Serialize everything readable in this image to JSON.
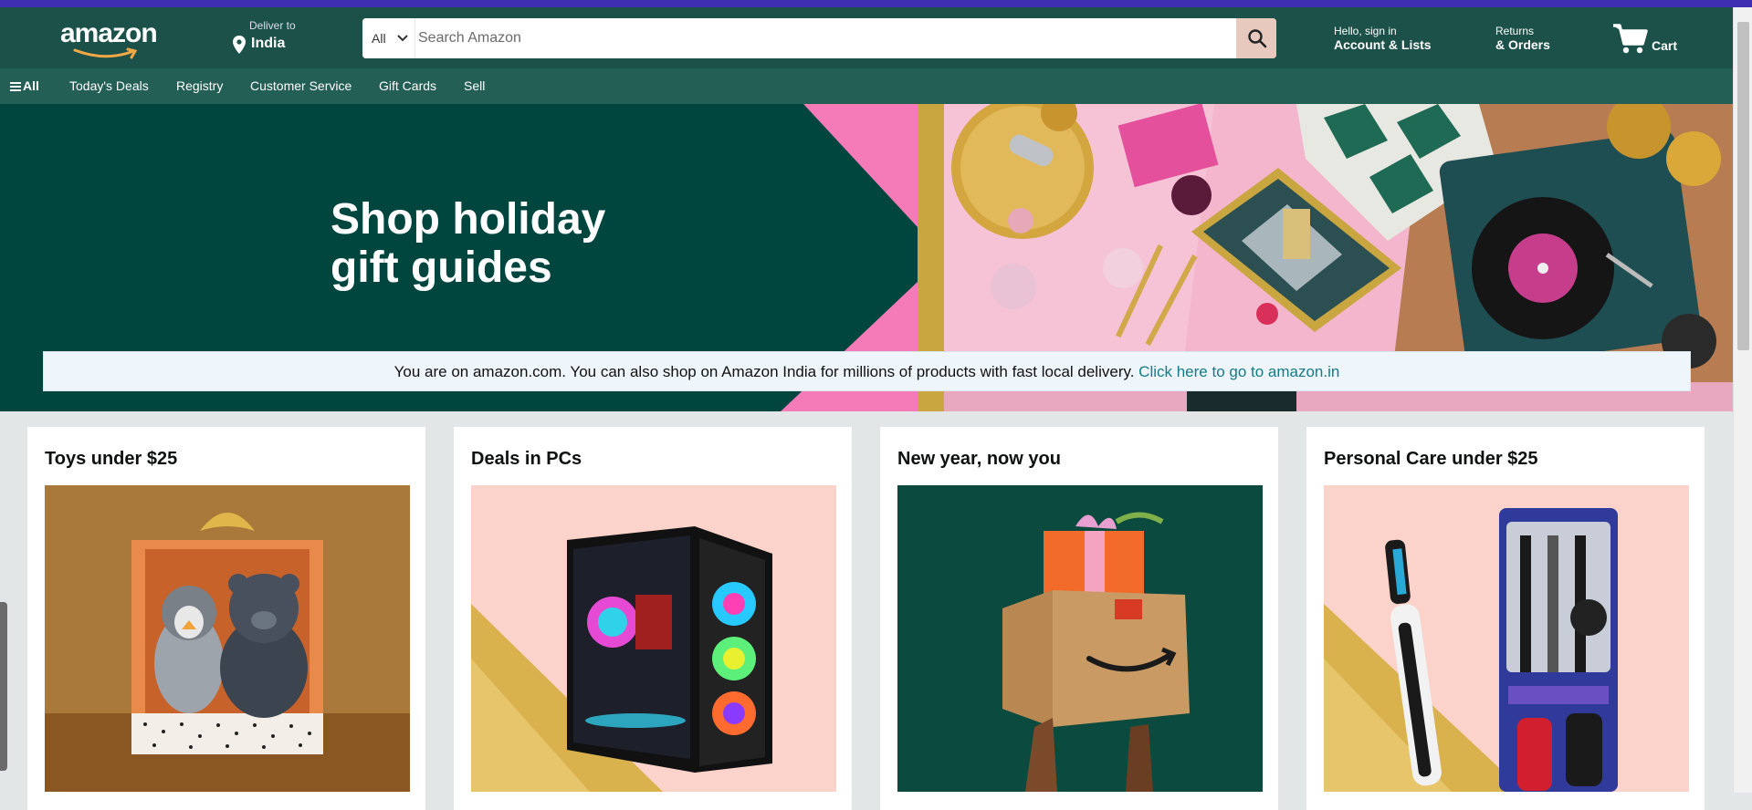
{
  "header": {
    "logo_text": "amazon",
    "deliver_small": "Deliver to",
    "deliver_location": "India",
    "search": {
      "category": "All",
      "placeholder": "Search Amazon"
    },
    "account_small": "Hello, sign in",
    "account_big": "Account & Lists",
    "orders_small": "Returns",
    "orders_big": "& Orders",
    "cart_label": "Cart"
  },
  "subnav": {
    "all_label": "All",
    "items": [
      "Today's Deals",
      "Registry",
      "Customer Service",
      "Gift Cards",
      "Sell"
    ]
  },
  "hero": {
    "title_line1": "Shop holiday",
    "title_line2": "gift guides"
  },
  "notice": {
    "text": "You are on amazon.com. You can also shop on Amazon India for millions of products with fast local delivery.",
    "link": "Click here to go to amazon.in"
  },
  "cards": [
    {
      "title": "Toys under $25"
    },
    {
      "title": "Deals in PCs"
    },
    {
      "title": "New year, now you"
    },
    {
      "title": "Personal Care under $25"
    }
  ],
  "colors": {
    "header_bg": "#1b5148",
    "subnav_bg": "#235f55",
    "hero_bg": "#00463f",
    "link": "#167a86",
    "search_btn": "#e8c9bd"
  }
}
